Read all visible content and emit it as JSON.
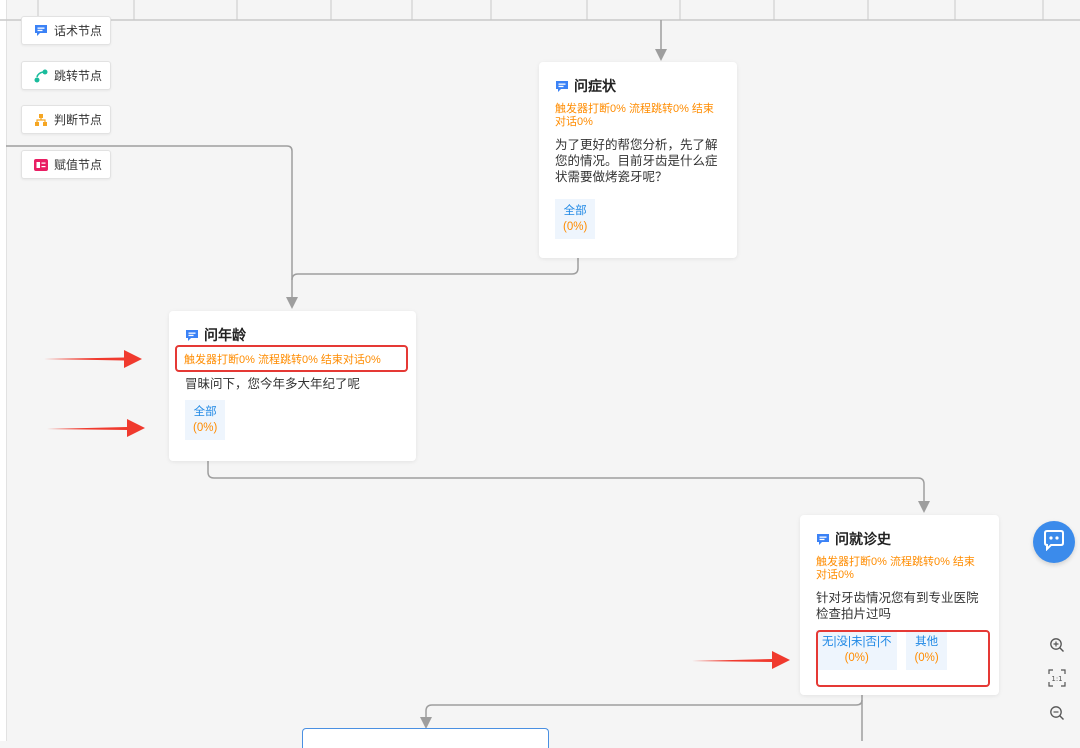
{
  "palette": {
    "items": [
      {
        "label": "话术节点",
        "icon": "speech-bubble-icon",
        "color": "#3b82f6"
      },
      {
        "label": "跳转节点",
        "icon": "jump-icon",
        "color": "#1abc9c"
      },
      {
        "label": "判断节点",
        "icon": "hierarchy-icon",
        "color": "#f5a623"
      },
      {
        "label": "赋值节点",
        "icon": "assign-icon",
        "color": "#e91e63"
      }
    ]
  },
  "nodes": {
    "symptom": {
      "title": "问症状",
      "stats": "触发器打断0% 流程跳转0% 结束对话0%",
      "desc": "为了更好的帮您分析，先了解您的情况。目前牙齿是什么症状需要做烤瓷牙呢？",
      "branches": [
        {
          "label": "全部",
          "pct": "(0%)"
        }
      ]
    },
    "age": {
      "title": "问年龄",
      "stats": "触发器打断0% 流程跳转0% 结束对话0%",
      "desc": "冒昧问下，您今年多大年纪了呢",
      "branches": [
        {
          "label": "全部",
          "pct": "(0%)"
        }
      ]
    },
    "history": {
      "title": "问就诊史",
      "stats": "触发器打断0% 流程跳转0% 结束对话0%",
      "desc": "针对牙齿情况您有到专业医院检查拍片过吗",
      "branches": [
        {
          "label": "无|没|未|否|不",
          "pct": "(0%)"
        },
        {
          "label": "其他",
          "pct": "(0%)"
        }
      ]
    }
  },
  "colors": {
    "accent": "#1e88e5",
    "stats": "#ff8c00",
    "annotation": "#e53935"
  },
  "tools": {
    "zoom_in": "zoom-in-icon",
    "fit": "fit-screen-icon",
    "zoom_out": "zoom-out-icon",
    "assistant": "robot-icon"
  }
}
